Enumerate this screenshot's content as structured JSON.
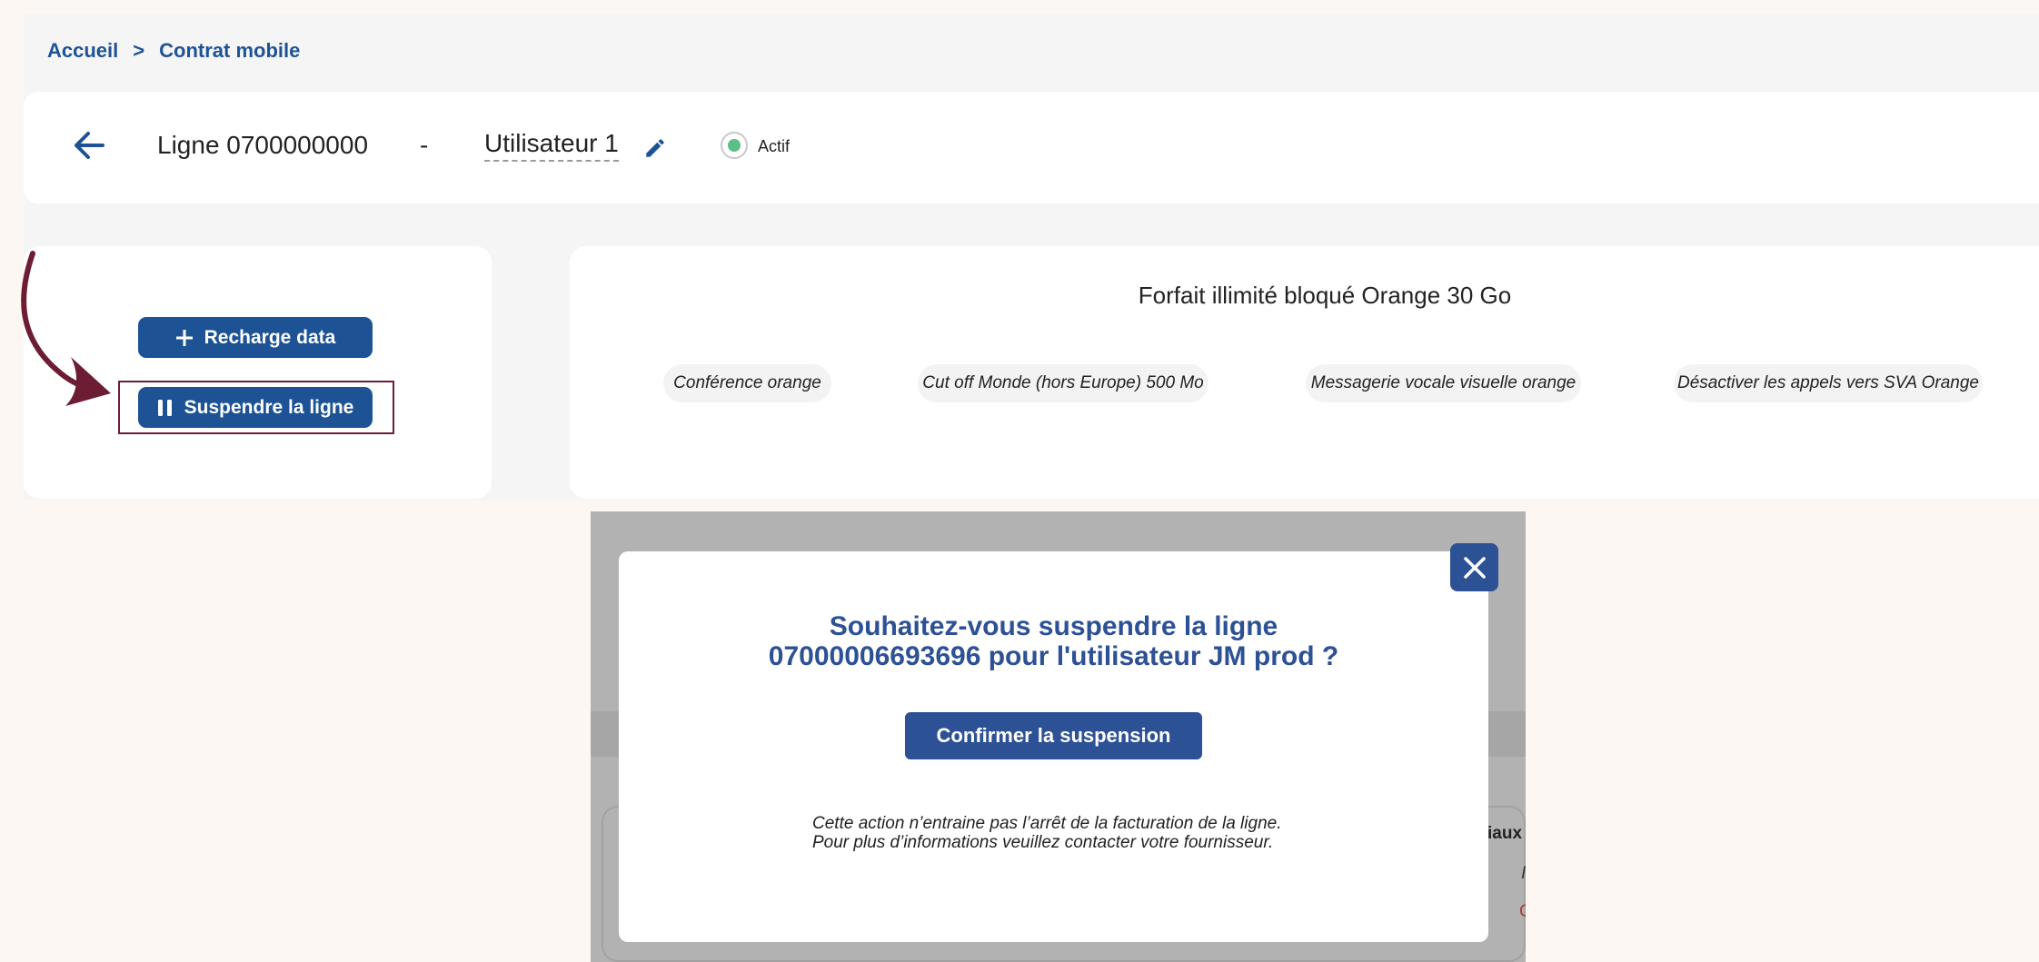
{
  "breadcrumb": {
    "home": "Accueil",
    "separator": ">",
    "current": "Contrat mobile"
  },
  "header": {
    "line_label": "Ligne 0700000000",
    "separator": "-",
    "user_name": "Utilisateur 1",
    "status": "Actif",
    "status_color": "#5cbf88"
  },
  "actions": {
    "recharge_label": "Recharge data",
    "suspend_label": "Suspendre la ligne"
  },
  "plan": {
    "title": "Forfait illimité bloqué Orange 30 Go",
    "options": [
      "Conférence orange",
      "Cut off Monde (hors Europe) 500 Mo",
      "Messagerie vocale visuelle orange",
      "Désactiver les appels vers SVA Orange"
    ]
  },
  "background_fragments": {
    "text_1": "iaux",
    "text_2": "I",
    "text_3": "C"
  },
  "modal": {
    "title_line1": "Souhaitez-vous suspendre la ligne",
    "title_line2": "07000006693696 pour l'utilisateur JM prod ?",
    "confirm_label": "Confirmer la suspension",
    "note_line1": "Cette action n’entraine pas l’arrêt de la facturation de la ligne.",
    "note_line2": "Pour plus d’informations veuillez contacter votre fournisseur."
  },
  "colors": {
    "primary": "#1d5395",
    "modal_primary": "#2d5195",
    "annotation": "#6d1d33"
  }
}
